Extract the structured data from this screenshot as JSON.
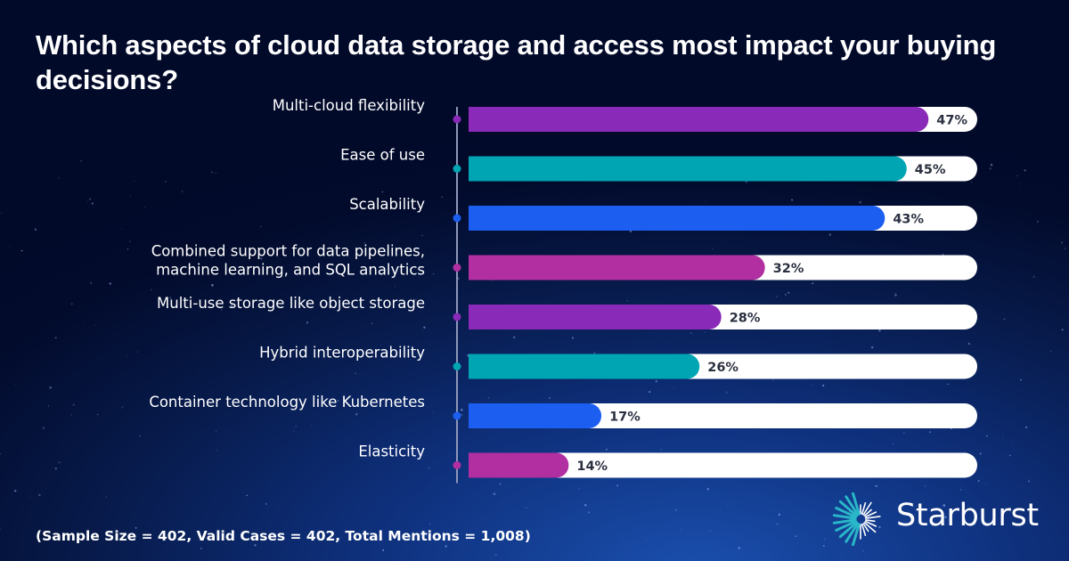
{
  "chart_data": {
    "type": "bar",
    "orientation": "horizontal",
    "title": "Which aspects of cloud data storage and access most impact your buying decisions?",
    "xlabel": "",
    "ylabel": "",
    "xlim": [
      0,
      100
    ],
    "unit": "%",
    "grid": false,
    "categories": [
      [
        "Multi-cloud flexibility"
      ],
      [
        "Ease of use"
      ],
      [
        "Scalability"
      ],
      [
        "Combined support for data pipelines,",
        "machine learning, and SQL analytics"
      ],
      [
        "Multi-use storage like object storage"
      ],
      [
        "Hybrid interoperability"
      ],
      [
        "Container technology like Kubernetes"
      ],
      [
        "Elasticity"
      ]
    ],
    "values": [
      47,
      45,
      43,
      32,
      28,
      26,
      17,
      14
    ],
    "value_labels": [
      "47%",
      "45%",
      "43%",
      "32%",
      "28%",
      "26%",
      "17%",
      "14%"
    ],
    "colors": [
      "#8a2ab8",
      "#00a5b4",
      "#1c5ef0",
      "#b12fa0",
      "#8a2ab8",
      "#00a5b4",
      "#1c5ef0",
      "#b12fa0"
    ],
    "track_color": "#ffffff",
    "axis_color": "#8d96b8"
  },
  "footnote": "(Sample Size = 402, Valid Cases = 402, Total Mentions = 1,008)",
  "brand": {
    "name": "Starburst",
    "logo_icon": "starburst-burst-icon",
    "accent": "#29b6c8"
  }
}
